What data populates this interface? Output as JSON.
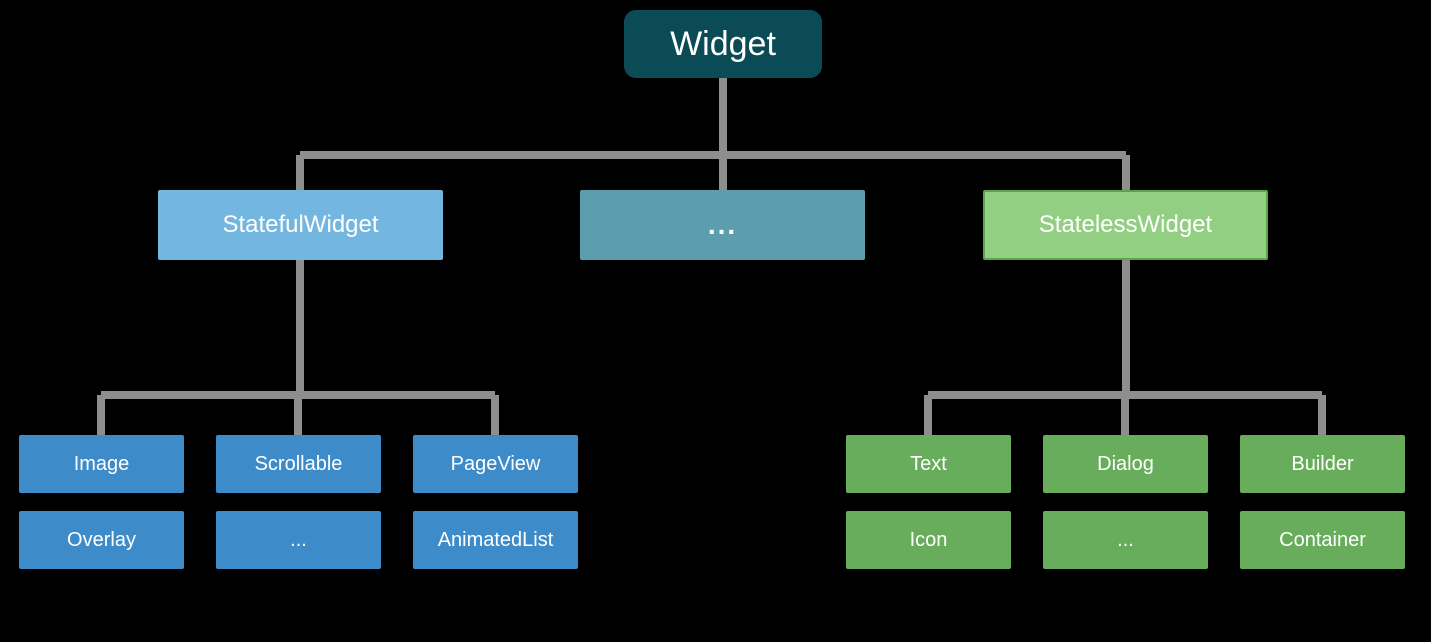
{
  "chart_data": {
    "type": "tree",
    "root": {
      "id": "widget",
      "label": "Widget",
      "color": "#0b4b56"
    },
    "children": [
      {
        "id": "stateful",
        "label": "StatefulWidget",
        "color": "#73b7e1",
        "children": [
          {
            "id": "image",
            "label": "Image",
            "color": "#3e8bc9"
          },
          {
            "id": "scrollable",
            "label": "Scrollable",
            "color": "#3e8bc9"
          },
          {
            "id": "pageview",
            "label": "PageView",
            "color": "#3e8bc9"
          },
          {
            "id": "overlay",
            "label": "Overlay",
            "color": "#3e8bc9"
          },
          {
            "id": "stateful-more",
            "label": "...",
            "color": "#3e8bc9"
          },
          {
            "id": "animatedlist",
            "label": "AnimatedList",
            "color": "#3e8bc9"
          }
        ]
      },
      {
        "id": "mid-more",
        "label": "...",
        "color": "#5d9eae",
        "children": []
      },
      {
        "id": "stateless",
        "label": "StatelessWidget",
        "color": "#93cf82",
        "children": [
          {
            "id": "text",
            "label": "Text",
            "color": "#67ad5b"
          },
          {
            "id": "dialog",
            "label": "Dialog",
            "color": "#67ad5b"
          },
          {
            "id": "builder",
            "label": "Builder",
            "color": "#67ad5b"
          },
          {
            "id": "icon",
            "label": "Icon",
            "color": "#67ad5b"
          },
          {
            "id": "stateless-more",
            "label": "...",
            "color": "#67ad5b"
          },
          {
            "id": "container",
            "label": "Container",
            "color": "#67ad5b"
          }
        ]
      }
    ]
  },
  "labels": {
    "root": "Widget",
    "stateful": "StatefulWidget",
    "midmore": "...",
    "stateless": "StatelessWidget",
    "image": "Image",
    "scrollable": "Scrollable",
    "pageview": "PageView",
    "overlay": "Overlay",
    "statefulmore": "...",
    "animatedlist": "AnimatedList",
    "text": "Text",
    "dialog": "Dialog",
    "builder": "Builder",
    "icon": "Icon",
    "statelessmore": "...",
    "container": "Container"
  },
  "annotation": ""
}
